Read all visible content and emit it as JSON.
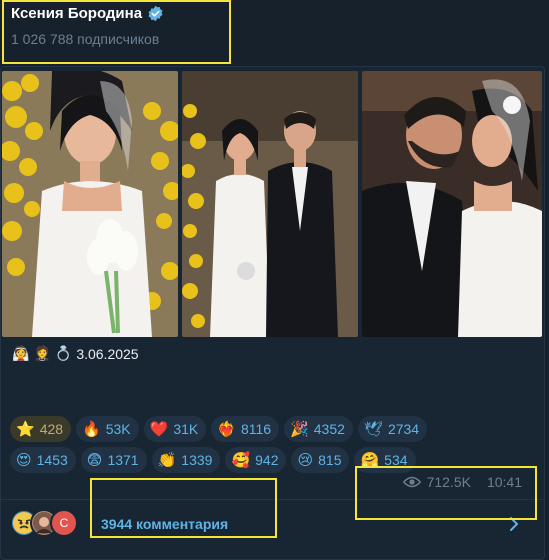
{
  "channel": {
    "name": "Ксения Бородина",
    "subscribers": "1 026 788 подписчиков"
  },
  "post": {
    "caption_date": "3.06.2025",
    "caption_icons": [
      "bride-emoji",
      "groom-emoji",
      "ring-emoji"
    ],
    "reactions": [
      [
        {
          "icon": "star-icon",
          "glyph": "⭐",
          "count": "428",
          "active": true
        },
        {
          "icon": "fire-icon",
          "glyph": "🔥",
          "count": "53K"
        },
        {
          "icon": "heart-icon",
          "glyph": "❤️",
          "count": "31K"
        },
        {
          "icon": "heart-on-fire-icon",
          "glyph": "❤️‍🔥",
          "count": "8116"
        },
        {
          "icon": "party-popper-icon",
          "glyph": "🎉",
          "count": "4352"
        },
        {
          "icon": "dove-icon",
          "glyph": "🕊",
          "count": "2734"
        }
      ],
      [
        {
          "icon": "heart-eyes-icon",
          "glyph": "😍",
          "count": "1453"
        },
        {
          "icon": "fearful-face-icon",
          "glyph": "😨",
          "count": "1371"
        },
        {
          "icon": "clapping-hands-icon",
          "glyph": "👏",
          "count": "1339"
        },
        {
          "icon": "smiling-hearts-icon",
          "glyph": "🥰",
          "count": "942"
        },
        {
          "icon": "crying-face-icon",
          "glyph": "😢",
          "count": "815"
        },
        {
          "icon": "hugging-face-icon",
          "glyph": "🤗",
          "count": "534"
        }
      ]
    ],
    "views": "712.5K",
    "time": "10:41",
    "comments_label": "3944 комментария",
    "avatar_letter": "С"
  },
  "colors": {
    "background": "#17212b",
    "post_background": "#182533",
    "accent": "#5fb3e6",
    "muted": "#6d7f8f",
    "highlight": "#f5e53b"
  }
}
